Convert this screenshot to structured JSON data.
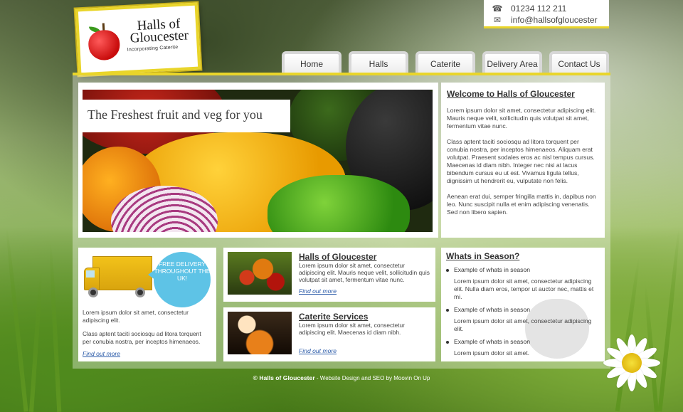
{
  "logo": {
    "name": "Halls of Gloucester",
    "subtitle": "Incorporating Caterite"
  },
  "contact": {
    "phone": "01234 112 211",
    "email": "info@hallsofgloucester",
    "phone_icon": "phone-icon",
    "email_icon": "envelope-icon"
  },
  "nav": {
    "items": [
      {
        "label": "Home"
      },
      {
        "label": "Halls"
      },
      {
        "label": "Caterite"
      },
      {
        "label": "Delivery Area"
      },
      {
        "label": "Contact Us"
      }
    ]
  },
  "hero": {
    "caption": "The Freshest fruit and veg for you"
  },
  "welcome": {
    "title": "Welcome to Halls of Gloucester",
    "paragraphs": [
      "Lorem ipsum dolor sit amet, consectetur adipiscing elit. Mauris neque velit, sollicitudin quis volutpat sit amet, fermentum vitae nunc.",
      "Class aptent taciti sociosqu ad litora torquent per conubia nostra, per inceptos himenaeos. Aliquam erat volutpat. Praesent sodales eros ac nisl tempus cursus. Maecenas id diam nibh. Integer nec nisi at lacus bibendum cursus eu ut est. Vivamus ligula tellus, dignissim ut hendrerit eu, vulputate non felis.",
      "Aenean erat dui, semper fringilla mattis in, dapibus non leo. Nunc suscipit nulla et enim adipiscing venenatis. Sed non libero sapien."
    ]
  },
  "delivery": {
    "bubble": "FREE DELIVERY THROUGHOUT THE UK!",
    "text1": "Lorem ipsum dolor sit amet, consectetur adipiscing elit.",
    "text2": "Class aptent taciti sociosqu ad litora torquent per conubia nostra, per inceptos himenaeos.",
    "link": "Find out more"
  },
  "features": [
    {
      "title": "Halls of Gloucester",
      "text": "Lorem ipsum dolor sit amet, consectetur adipiscing elit. Mauris neque velit, sollicitudin quis volutpat sit amet, fermentum vitae nunc.",
      "link": "Find out more"
    },
    {
      "title": "Caterite Services",
      "text": "Lorem ipsum dolor sit amet, consectetur adipiscing elit. Maecenas id diam nibh.",
      "link": "Find out more"
    }
  ],
  "season": {
    "title": "Whats in Season?",
    "items": [
      {
        "label": "Example of whats in season",
        "text": "Lorem ipsum dolor sit amet, consectetur adipiscing elit. Nulla diam eros, tempor ut auctor nec, mattis et mi."
      },
      {
        "label": "Example of whats in season",
        "text": "Lorem ipsum dolor sit amet, consectetur adipiscing elit."
      },
      {
        "label": "Example of whats in season",
        "text": "Lorem ipsum dolor sit amet."
      }
    ]
  },
  "footer": {
    "copyright": "© Halls of Gloucester",
    "credit": " - Website Design and SEO by Moovin On Up"
  },
  "colors": {
    "accent": "#e9d52a",
    "link": "#2a5aa8",
    "bubble": "#5ec3e6"
  }
}
